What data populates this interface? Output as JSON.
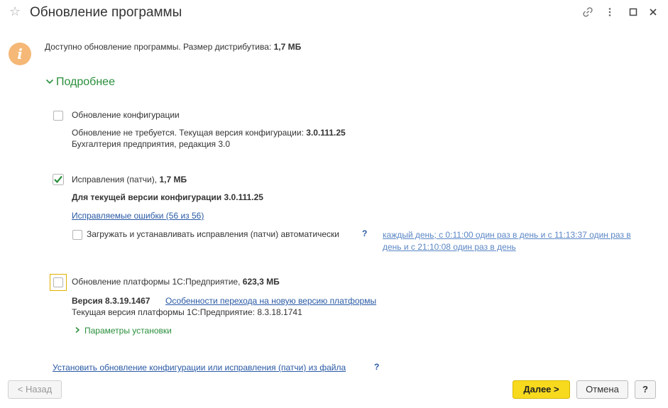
{
  "window": {
    "title": "Обновление программы"
  },
  "info": {
    "text": "Доступно обновление программы. Размер дистрибутива:",
    "size": "1,7 МБ"
  },
  "details_toggle": "Подробнее",
  "config_update": {
    "label": "Обновление конфигурации",
    "status": "Обновление не требуется. Текущая версия конфигурации:",
    "version": "3.0.111.25",
    "edition": "Бухгалтерия предприятия, редакция 3.0",
    "checked": false
  },
  "patches": {
    "label": "Исправления (патчи),",
    "size": "1,7 МБ",
    "checked": true,
    "for_version": "Для текущей версии конфигурации 3.0.111.25",
    "fixed_errors_link": "Исправляемые ошибки (56 из 56)",
    "auto_label": "Загружать и устанавливать исправления (патчи) автоматически",
    "auto_help": "?",
    "schedule_line1": "каждый день; с 0:11:00 один раз в день и с 11:13:37 один раз в",
    "schedule_line2": "день и с 21:10:08 один раз в день"
  },
  "platform": {
    "label": "Обновление платформы 1С:Предприятие,",
    "size": "623,3 МБ",
    "checked": false,
    "version": "Версия 8.3.19.1467",
    "features_link": "Особенности перехода на новую версию платформы",
    "current": "Текущая версия платформы 1С:Предприятие: 8.3.18.1741",
    "install_params": "Параметры установки"
  },
  "install_from_file_link": "Установить обновление конфигурации или исправления (патчи) из файла",
  "install_from_file_help": "?",
  "buttons": {
    "back": "< Назад",
    "next": "Далее >",
    "cancel": "Отмена",
    "help": "?"
  }
}
